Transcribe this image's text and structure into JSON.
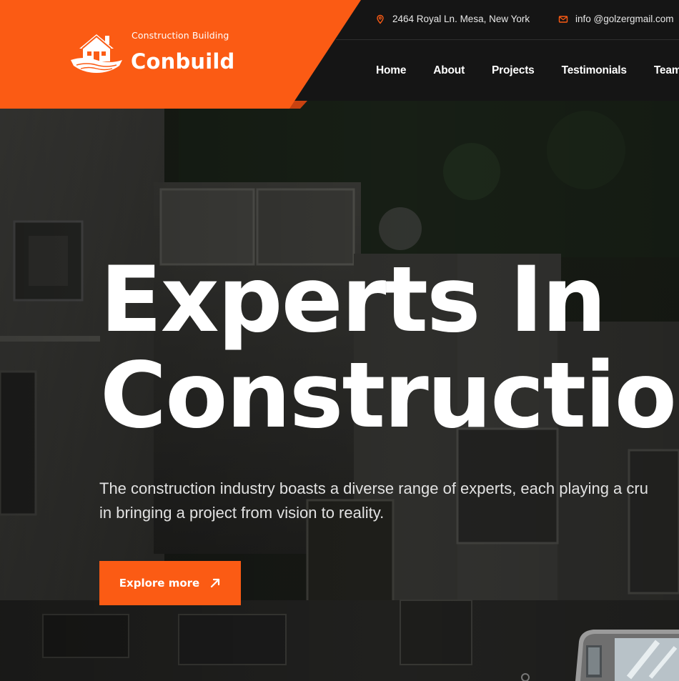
{
  "brand": {
    "tagline": "Construction Building",
    "name": "Conbuild",
    "accent": "#fb5b14"
  },
  "topbar": {
    "address": "2464 Royal Ln. Mesa, New York",
    "address_icon": "map-pin-icon",
    "email": "info @golzergmail.com",
    "email_icon": "mail-icon"
  },
  "nav": {
    "items": [
      {
        "label": "Home"
      },
      {
        "label": "About"
      },
      {
        "label": "Projects"
      },
      {
        "label": "Testimonials"
      },
      {
        "label": "Team"
      }
    ]
  },
  "hero": {
    "title_line1": "Experts In",
    "title_line2": "Constructio",
    "description_line1": "The construction industry boasts a diverse range of experts, each playing a cru",
    "description_line2": "in bringing a project from vision to reality.",
    "cta_label": "Explore more",
    "cta_icon": "arrow-up-right-icon"
  }
}
